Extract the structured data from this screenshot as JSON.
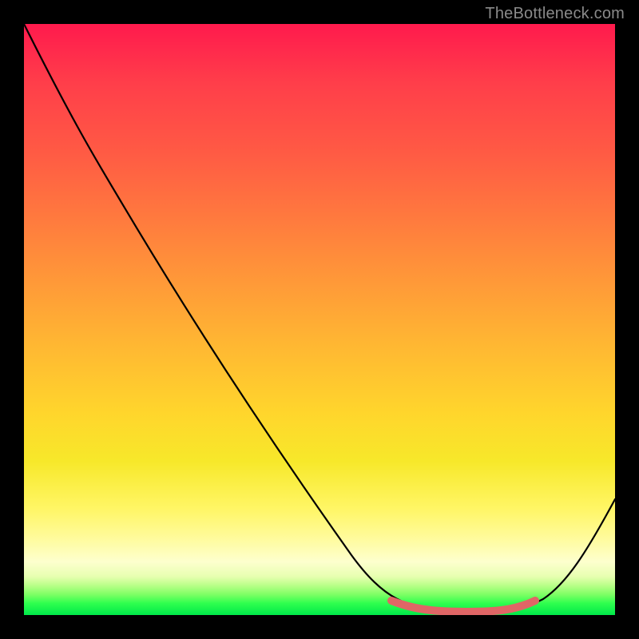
{
  "attribution": "TheBottleneck.com",
  "chart_data": {
    "type": "line",
    "title": "",
    "xlabel": "",
    "ylabel": "",
    "x_range_normalized": [
      0,
      1
    ],
    "y_range_normalized": [
      0,
      1
    ],
    "series": [
      {
        "name": "bottleneck-curve",
        "x": [
          0.0,
          0.05,
          0.1,
          0.15,
          0.2,
          0.25,
          0.3,
          0.35,
          0.4,
          0.45,
          0.5,
          0.55,
          0.6,
          0.65,
          0.7,
          0.75,
          0.8,
          0.85,
          0.9,
          0.95,
          1.0
        ],
        "y": [
          1.0,
          0.88,
          0.78,
          0.7,
          0.62,
          0.54,
          0.46,
          0.39,
          0.32,
          0.25,
          0.18,
          0.12,
          0.07,
          0.04,
          0.02,
          0.01,
          0.01,
          0.02,
          0.05,
          0.11,
          0.2
        ]
      }
    ],
    "highlight_range": {
      "name": "optimal-range",
      "x_start": 0.62,
      "x_end": 0.87,
      "color": "#e06666"
    },
    "background_gradient": {
      "top": "#ff1a4d",
      "middle": "#ffd62c",
      "bottom": "#00e84a"
    },
    "axis_visible": false,
    "grid": false
  }
}
